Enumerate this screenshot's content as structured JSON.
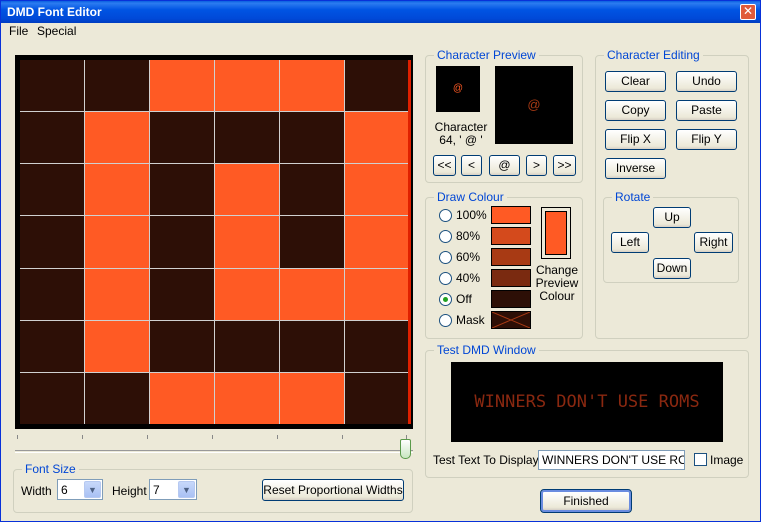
{
  "window": {
    "title": "DMD Font Editor",
    "close_symbol": "✕"
  },
  "menu": {
    "file": "File",
    "special": "Special"
  },
  "grid": {
    "columns": 6,
    "rows": [
      [
        0,
        0,
        1,
        1,
        1,
        0
      ],
      [
        0,
        1,
        0,
        0,
        0,
        1
      ],
      [
        0,
        1,
        0,
        1,
        0,
        1
      ],
      [
        0,
        1,
        0,
        1,
        0,
        1
      ],
      [
        0,
        1,
        0,
        1,
        1,
        1
      ],
      [
        0,
        1,
        0,
        0,
        0,
        0
      ],
      [
        0,
        0,
        1,
        1,
        1,
        0
      ]
    ],
    "on_color": "#ff5a24",
    "off_color": "#2d0f06"
  },
  "character_preview": {
    "legend": "Character Preview",
    "small_glyph": "@",
    "large_glyph": "@",
    "label_line1": "Character",
    "label_line2": "64, ' @ '",
    "nav": {
      "first": "<<",
      "prev": "<",
      "current": "@",
      "next": ">",
      "last": ">>"
    }
  },
  "character_editing": {
    "legend": "Character Editing",
    "clear": "Clear",
    "undo": "Undo",
    "copy": "Copy",
    "paste": "Paste",
    "flip_x": "Flip X",
    "flip_y": "Flip Y",
    "inverse": "Inverse"
  },
  "rotate": {
    "legend": "Rotate",
    "up": "Up",
    "left": "Left",
    "right": "Right",
    "down": "Down"
  },
  "draw_colour": {
    "legend": "Draw Colour",
    "options": [
      {
        "label": "100%",
        "color": "#ff5a24",
        "checked": false
      },
      {
        "label": "80%",
        "color": "#d44a1c",
        "checked": false
      },
      {
        "label": "60%",
        "color": "#a83a14",
        "checked": false
      },
      {
        "label": "40%",
        "color": "#7a2a10",
        "checked": false
      },
      {
        "label": "Off",
        "color": "#2d0f06",
        "checked": true
      },
      {
        "label": "Mask",
        "color": "#2d0f06",
        "checked": false
      }
    ],
    "change_line1": "Change",
    "change_line2": "Preview",
    "change_line3": "Colour"
  },
  "test_dmd": {
    "legend": "Test DMD Window",
    "display_text": "WINNERS DON'T USE ROMS",
    "input_label": "Test Text To Display",
    "input_value": "WINNERS DON'T USE ROMS",
    "image_label": "Image"
  },
  "font_size": {
    "legend": "Font Size",
    "width_label": "Width",
    "width_value": "6",
    "height_label": "Height",
    "height_value": "7",
    "reset_label": "Reset Proportional Widths"
  },
  "finished_label": "Finished"
}
